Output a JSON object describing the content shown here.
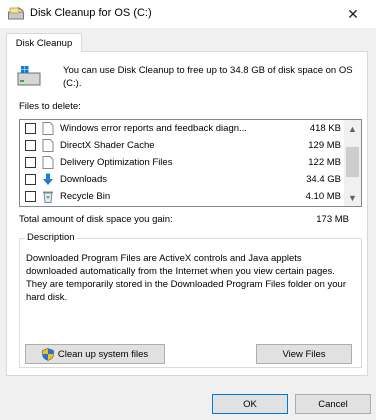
{
  "window": {
    "title": "Disk Cleanup for OS (C:)",
    "close_glyph": "✕"
  },
  "tab": {
    "label": "Disk Cleanup"
  },
  "intro": {
    "text": "You can use Disk Cleanup to free up to 34.8 GB of disk space on OS (C:)."
  },
  "files": {
    "label": "Files to delete:",
    "items": [
      {
        "name": "Windows error reports and feedback diagn...",
        "size": "418 KB",
        "checked": false,
        "icon": "file-icon"
      },
      {
        "name": "DirectX Shader Cache",
        "size": "129 MB",
        "checked": false,
        "icon": "file-icon"
      },
      {
        "name": "Delivery Optimization Files",
        "size": "122 MB",
        "checked": false,
        "icon": "file-icon"
      },
      {
        "name": "Downloads",
        "size": "34.4 GB",
        "checked": false,
        "icon": "download-arrow-icon"
      },
      {
        "name": "Recycle Bin",
        "size": "4.10 MB",
        "checked": false,
        "icon": "recycle-bin-icon"
      }
    ]
  },
  "total": {
    "label": "Total amount of disk space you gain:",
    "value": "173 MB"
  },
  "description": {
    "legend": "Description",
    "text": "Downloaded Program Files are ActiveX controls and Java applets downloaded automatically from the Internet when you view certain pages. They are temporarily stored in the Downloaded Program Files folder on your hard disk."
  },
  "buttons": {
    "cleanup_system": "Clean up system files",
    "view_files": "View Files",
    "ok": "OK",
    "cancel": "Cancel"
  },
  "scrollbar": {
    "up_glyph": "▲",
    "down_glyph": "▼"
  },
  "colors": {
    "accent": "#0078d7",
    "download_arrow": "#1e7bd6"
  }
}
